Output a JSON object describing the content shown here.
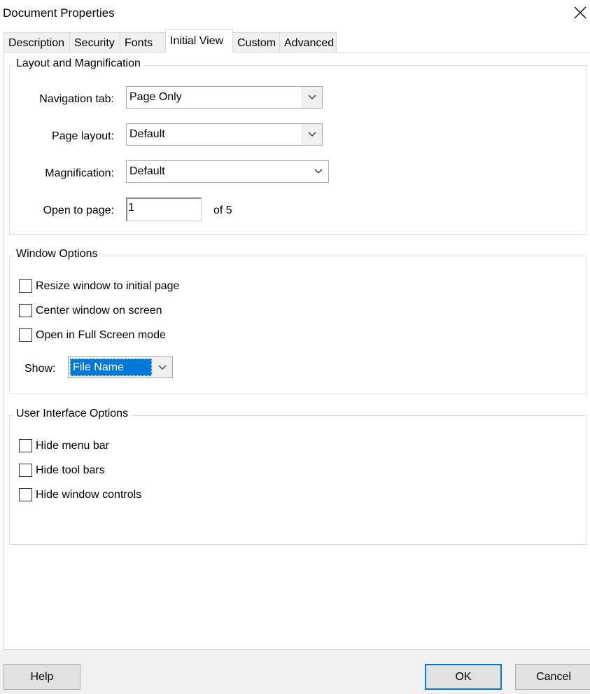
{
  "window": {
    "title": "Document Properties"
  },
  "tabs": [
    {
      "label": "Description"
    },
    {
      "label": "Security"
    },
    {
      "label": "Fonts"
    },
    {
      "label": "Initial View"
    },
    {
      "label": "Custom"
    },
    {
      "label": "Advanced"
    }
  ],
  "active_tab": "Initial View",
  "layout_group": {
    "label": "Layout and Magnification",
    "navigation_tab": {
      "label": "Navigation tab:",
      "value": "Page Only"
    },
    "page_layout": {
      "label": "Page layout:",
      "value": "Default"
    },
    "magnification": {
      "label": "Magnification:",
      "value": "Default"
    },
    "open_to_page": {
      "label": "Open to page:",
      "value": "1",
      "of": "of 5"
    }
  },
  "window_group": {
    "label": "Window Options",
    "options": [
      {
        "label": "Resize window to initial page",
        "checked": false
      },
      {
        "label": "Center window on screen",
        "checked": false
      },
      {
        "label": "Open in Full Screen mode",
        "checked": false
      }
    ],
    "show": {
      "label": "Show:",
      "value": "File Name"
    }
  },
  "ui_group": {
    "label": "User Interface Options",
    "options": [
      {
        "label": "Hide menu bar",
        "checked": false
      },
      {
        "label": "Hide tool bars",
        "checked": false
      },
      {
        "label": "Hide window controls",
        "checked": false
      }
    ]
  },
  "buttons": {
    "help": "Help",
    "ok": "OK",
    "cancel": "Cancel"
  },
  "colors": {
    "accent": "#0078d7",
    "face": "#f0f0f0",
    "border": "#adadad"
  },
  "icons": {
    "close": "close-icon",
    "dropdown": "chevron-down-icon"
  }
}
